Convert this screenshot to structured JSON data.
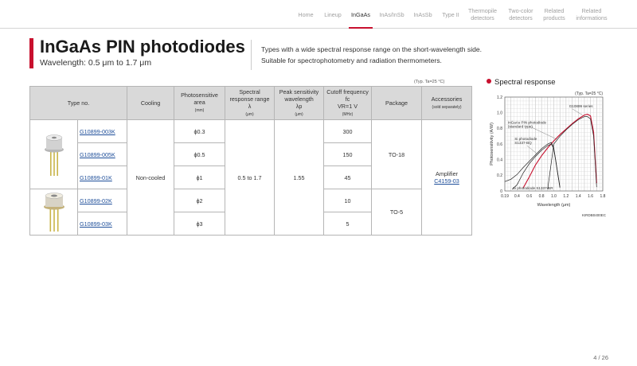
{
  "nav": {
    "items": [
      {
        "label": "Home",
        "active": false
      },
      {
        "label": "Lineup",
        "active": false
      },
      {
        "label": "InGaAs",
        "active": true
      },
      {
        "label": "InAs/InSb",
        "active": false
      },
      {
        "label": "InAsSb",
        "active": false
      },
      {
        "label": "Type II",
        "active": false
      },
      {
        "label": "Thermopile\ndetectors",
        "active": false
      },
      {
        "label": "Two-color\ndetectors",
        "active": false
      },
      {
        "label": "Related\nproducts",
        "active": false
      },
      {
        "label": "Related\ninformations",
        "active": false
      }
    ]
  },
  "header": {
    "title": "InGaAs PIN photodiodes",
    "subtitle": "Wavelength: 0.5 μm to 1.7 μm",
    "description_line1": "Types with a wide spectral response range on the short-wavelength side.",
    "description_line2": "Suitable for spectrophotometry and radiation thermometers."
  },
  "table": {
    "typ_note": "(Typ. Ta=25 °C)",
    "headers": {
      "type_no": "Type no.",
      "cooling": "Cooling",
      "area": "Photosensitive\narea",
      "area_unit": "(mm)",
      "spectral": "Spectral\nresponse range\nλ",
      "spectral_unit": "(μm)",
      "peak": "Peak sensitivity\nwavelength\nλp",
      "peak_unit": "(μm)",
      "cutoff": "Cutoff frequency\nfc\nVR=1 V",
      "cutoff_unit": "(MHz)",
      "package": "Package",
      "accessories": "Accessories",
      "accessories_unit": "(sold separately)"
    },
    "rows": [
      {
        "type_no": "G10899-003K",
        "area": "ϕ0.3",
        "cutoff": "300"
      },
      {
        "type_no": "G10899-005K",
        "area": "ϕ0.5",
        "cutoff": "150"
      },
      {
        "type_no": "G10899-01K",
        "area": "ϕ1",
        "cutoff": "45"
      },
      {
        "type_no": "G10899-02K",
        "area": "ϕ2",
        "cutoff": "10"
      },
      {
        "type_no": "G10899-03K",
        "area": "ϕ3",
        "cutoff": "5"
      }
    ],
    "cooling": "Non-cooled",
    "spectral_range": "0.5 to 1.7",
    "peak_wavelength": "1.55",
    "package_1": "TO-18",
    "package_2": "TO-5",
    "accessory_label": "Amplifier",
    "accessory_link": "C4159-03"
  },
  "chart_section": {
    "heading": "Spectral response",
    "accent_color": "#c8102e"
  },
  "chart_data": {
    "type": "line",
    "title": "",
    "note": "(Typ. Ta=25 °C)",
    "xlabel": "Wavelength (μm)",
    "ylabel": "Photosensitivity (A/W)",
    "xlim": [
      0.19,
      1.8
    ],
    "ylim": [
      0,
      1.2
    ],
    "x_ticks": [
      "0.19",
      "0.4",
      "0.6",
      "0.8",
      "1.0",
      "1.2",
      "1.4",
      "1.6",
      "1.8"
    ],
    "y_ticks": [
      "0",
      "0.2",
      "0.4",
      "0.6",
      "0.8",
      "1.0",
      "1.2"
    ],
    "grid": true,
    "footer_code": "KIRDB0400EC",
    "series": [
      {
        "name": "G10899 series",
        "color": "#c8102e",
        "x": [
          0.5,
          0.6,
          0.7,
          0.8,
          0.9,
          1.0,
          1.1,
          1.2,
          1.3,
          1.4,
          1.5,
          1.55,
          1.6,
          1.65,
          1.7
        ],
        "y": [
          0.04,
          0.18,
          0.33,
          0.45,
          0.55,
          0.64,
          0.72,
          0.79,
          0.86,
          0.92,
          0.97,
          0.98,
          0.96,
          0.75,
          0.1
        ]
      },
      {
        "name": "InGaAs PIN photodiode\n(standard type)",
        "color": "#222222",
        "x": [
          0.9,
          1.0,
          1.1,
          1.2,
          1.3,
          1.4,
          1.5,
          1.55,
          1.6,
          1.65,
          1.7
        ],
        "y": [
          0.02,
          0.6,
          0.7,
          0.78,
          0.85,
          0.91,
          0.95,
          0.95,
          0.92,
          0.7,
          0.05
        ]
      },
      {
        "name": "Si photodiode\nS1337-BQ",
        "color": "#222222",
        "x": [
          0.19,
          0.3,
          0.4,
          0.5,
          0.6,
          0.7,
          0.8,
          0.9,
          0.96,
          1.0,
          1.1
        ],
        "y": [
          0.12,
          0.15,
          0.21,
          0.3,
          0.38,
          0.46,
          0.54,
          0.6,
          0.62,
          0.55,
          0.05
        ]
      },
      {
        "name": "Si photodiode S1337-BR",
        "color": "#222222",
        "x": [
          0.32,
          0.4,
          0.5,
          0.6,
          0.7,
          0.8,
          0.9,
          0.96,
          1.0,
          1.1
        ],
        "y": [
          0.02,
          0.08,
          0.23,
          0.35,
          0.44,
          0.52,
          0.58,
          0.6,
          0.54,
          0.04
        ]
      }
    ],
    "annotations": [
      "G10899 series",
      "InGaAs PIN photodiode\n(standard type)",
      "Si photodiode\nS1337-BQ",
      "Si photodiode S1337-BR"
    ]
  },
  "page": {
    "number": "4 / 26"
  }
}
